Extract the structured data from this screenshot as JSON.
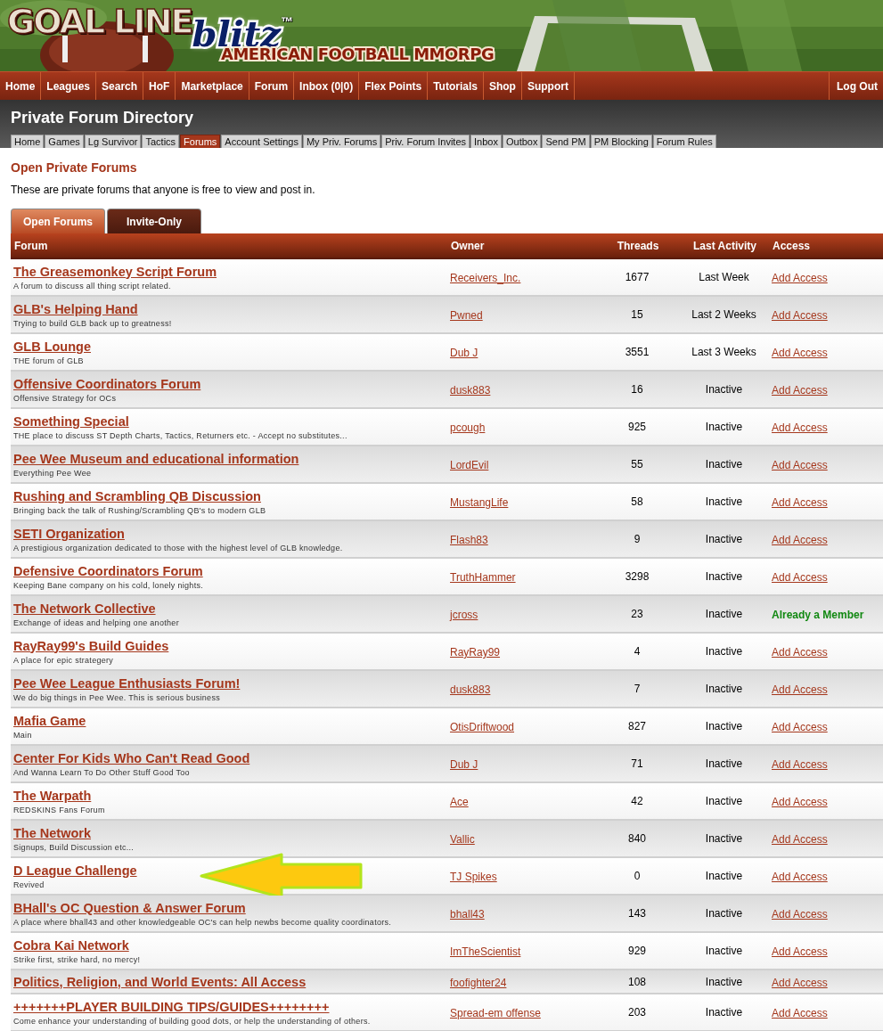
{
  "logo": {
    "main": "GOAL LINE",
    "script": "blitz",
    "mark": "™",
    "tagline": "AMERICAN FOOTBALL MMORPG"
  },
  "nav": {
    "items": [
      "Home",
      "Leagues",
      "Search",
      "HoF",
      "Marketplace",
      "Forum",
      "Inbox (0|0)",
      "Flex Points",
      "Tutorials",
      "Shop",
      "Support"
    ],
    "right": "Log Out"
  },
  "page_title": "Private Forum Directory",
  "subnav": [
    {
      "label": "Home",
      "selected": false
    },
    {
      "label": "Games",
      "selected": false
    },
    {
      "label": "Lg Survivor",
      "selected": false
    },
    {
      "label": "Tactics",
      "selected": false
    },
    {
      "label": "Forums",
      "selected": true
    },
    {
      "label": "Account Settings",
      "selected": false
    },
    {
      "label": "My Priv. Forums",
      "selected": false
    },
    {
      "label": "Priv. Forum Invites",
      "selected": false
    },
    {
      "label": "Inbox",
      "selected": false
    },
    {
      "label": "Outbox",
      "selected": false
    },
    {
      "label": "Send PM",
      "selected": false
    },
    {
      "label": "PM Blocking",
      "selected": false
    },
    {
      "label": "Forum Rules",
      "selected": false
    }
  ],
  "section": {
    "heading": "Open Private Forums",
    "intro": "These are private forums that anyone is free to view and post in."
  },
  "tabs": [
    {
      "label": "Open Forums",
      "selected": true
    },
    {
      "label": "Invite-Only",
      "selected": false
    }
  ],
  "table": {
    "columns": [
      "Forum",
      "Owner",
      "Threads",
      "Last Activity",
      "Access"
    ],
    "rows": [
      {
        "forum": "The Greasemonkey Script Forum",
        "description": "A forum to discuss all thing script related.",
        "owner": "Receivers_Inc.",
        "threads": "1677",
        "last_activity": "Last Week",
        "access": {
          "kind": "link",
          "text": "Add Access"
        }
      },
      {
        "forum": "GLB's Helping Hand",
        "description": "Trying to build GLB back up to greatness!",
        "owner": "Pwned",
        "threads": "15",
        "last_activity": "Last 2 Weeks",
        "access": {
          "kind": "link",
          "text": "Add Access"
        }
      },
      {
        "forum": "GLB Lounge",
        "description": "THE forum of GLB",
        "owner": "Dub J",
        "threads": "3551",
        "last_activity": "Last 3 Weeks",
        "access": {
          "kind": "link",
          "text": "Add Access"
        }
      },
      {
        "forum": "Offensive Coordinators Forum",
        "description": "Offensive Strategy for OCs",
        "owner": "dusk883",
        "threads": "16",
        "last_activity": "Inactive",
        "access": {
          "kind": "link",
          "text": "Add Access"
        }
      },
      {
        "forum": "Something Special",
        "description": "THE place to discuss ST Depth Charts, Tactics, Returners etc. - Accept no substitutes...",
        "owner": "pcough",
        "threads": "925",
        "last_activity": "Inactive",
        "access": {
          "kind": "link",
          "text": "Add Access"
        }
      },
      {
        "forum": "Pee Wee Museum and educational information",
        "description": "Everything Pee Wee",
        "owner": "LordEvil",
        "threads": "55",
        "last_activity": "Inactive",
        "access": {
          "kind": "link",
          "text": "Add Access"
        }
      },
      {
        "forum": "Rushing and Scrambling QB Discussion",
        "description": "Bringing back the talk of Rushing/Scrambling QB's to modern GLB",
        "owner": "MustangLife",
        "threads": "58",
        "last_activity": "Inactive",
        "access": {
          "kind": "link",
          "text": "Add Access"
        }
      },
      {
        "forum": "SETI Organization",
        "description": "A prestigious organization dedicated to those with the highest level of GLB knowledge.",
        "owner": "Flash83",
        "threads": "9",
        "last_activity": "Inactive",
        "access": {
          "kind": "link",
          "text": "Add Access"
        }
      },
      {
        "forum": "Defensive Coordinators Forum",
        "description": "Keeping Bane company on his cold, lonely nights.",
        "owner": "TruthHammer",
        "threads": "3298",
        "last_activity": "Inactive",
        "access": {
          "kind": "link",
          "text": "Add Access"
        }
      },
      {
        "forum": "The Network Collective",
        "description": "Exchange of ideas and helping one another",
        "owner": "jcross",
        "threads": "23",
        "last_activity": "Inactive",
        "access": {
          "kind": "member",
          "text": "Already a Member"
        }
      },
      {
        "forum": "RayRay99's Build Guides",
        "description": "A place for epic strategery",
        "owner": "RayRay99",
        "threads": "4",
        "last_activity": "Inactive",
        "access": {
          "kind": "link",
          "text": "Add Access"
        }
      },
      {
        "forum": "Pee Wee League Enthusiasts Forum!",
        "description": "We do big things in Pee Wee. This is serious business",
        "owner": "dusk883",
        "threads": "7",
        "last_activity": "Inactive",
        "access": {
          "kind": "link",
          "text": "Add Access"
        }
      },
      {
        "forum": "Mafia Game",
        "description": "Main",
        "owner": "OtisDriftwood",
        "threads": "827",
        "last_activity": "Inactive",
        "access": {
          "kind": "link",
          "text": "Add Access"
        }
      },
      {
        "forum": "Center For Kids Who Can't Read Good",
        "description": "And Wanna Learn To Do Other Stuff Good Too",
        "owner": "Dub J",
        "threads": "71",
        "last_activity": "Inactive",
        "access": {
          "kind": "link",
          "text": "Add Access"
        }
      },
      {
        "forum": "The Warpath",
        "description": "REDSKINS Fans Forum",
        "owner": "Ace",
        "threads": "42",
        "last_activity": "Inactive",
        "access": {
          "kind": "link",
          "text": "Add Access"
        }
      },
      {
        "forum": "The Network",
        "description": "Signups, Build Discussion etc...",
        "owner": "Vallic",
        "threads": "840",
        "last_activity": "Inactive",
        "access": {
          "kind": "link",
          "text": "Add Access"
        }
      },
      {
        "forum": "D League Challenge",
        "description": "Revived",
        "owner": "TJ Spikes",
        "threads": "0",
        "last_activity": "Inactive",
        "access": {
          "kind": "link",
          "text": "Add Access"
        },
        "highlighted_by_arrow": true
      },
      {
        "forum": "BHall's OC Question & Answer Forum",
        "description": "A place where bhall43 and other knowledgeable OC's can help newbs become quality coordinators.",
        "owner": "bhall43",
        "threads": "143",
        "last_activity": "Inactive",
        "access": {
          "kind": "link",
          "text": "Add Access"
        }
      },
      {
        "forum": "Cobra Kai Network",
        "description": "Strike first, strike hard, no mercy!",
        "owner": "ImTheScientist",
        "threads": "929",
        "last_activity": "Inactive",
        "access": {
          "kind": "link",
          "text": "Add Access"
        }
      },
      {
        "forum": "Politics, Religion, and World Events: All Access",
        "owner": "foofighter24",
        "threads": "108",
        "last_activity": "Inactive",
        "access": {
          "kind": "link",
          "text": "Add Access"
        }
      },
      {
        "forum": "+++++++PLAYER BUILDING TIPS/GUIDES++++++++",
        "description": "Come enhance your understanding of building good dots, or help the understanding of others.",
        "owner": "Spread-em offense",
        "threads": "203",
        "last_activity": "Inactive",
        "access": {
          "kind": "link",
          "text": "Add Access"
        }
      }
    ]
  }
}
